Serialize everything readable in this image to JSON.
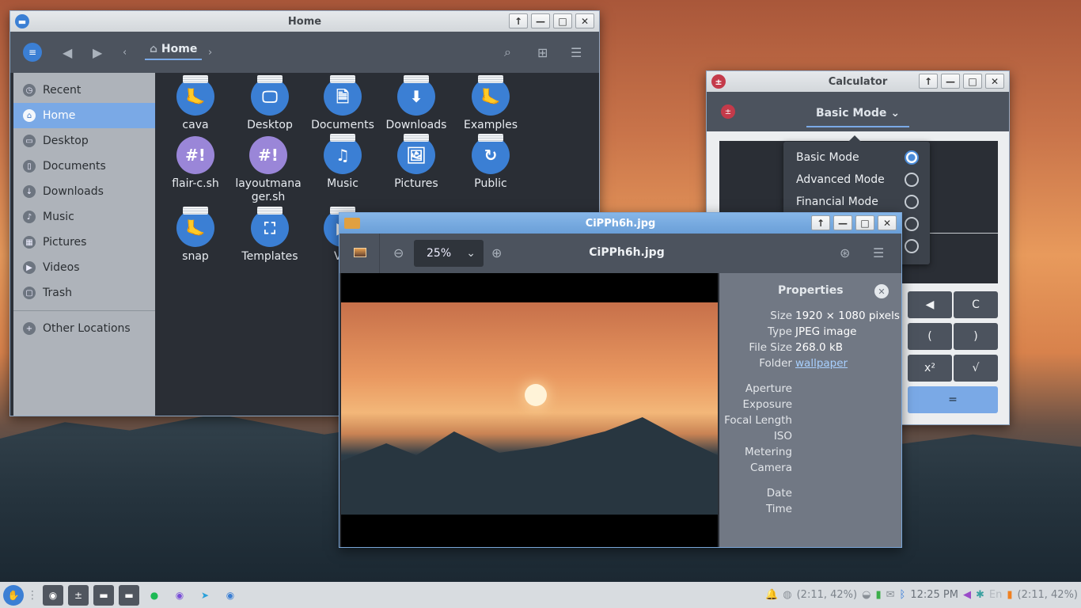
{
  "files_window": {
    "title": "Home",
    "breadcrumb": "Home",
    "sidebar": [
      {
        "label": "Recent",
        "icon": "clock-icon"
      },
      {
        "label": "Home",
        "icon": "home-icon",
        "active": true
      },
      {
        "label": "Desktop",
        "icon": "desktop-icon"
      },
      {
        "label": "Documents",
        "icon": "documents-icon"
      },
      {
        "label": "Downloads",
        "icon": "downloads-icon"
      },
      {
        "label": "Music",
        "icon": "music-icon"
      },
      {
        "label": "Pictures",
        "icon": "pictures-icon"
      },
      {
        "label": "Videos",
        "icon": "videos-icon"
      },
      {
        "label": "Trash",
        "icon": "trash-icon"
      },
      {
        "label": "Other Locations",
        "icon": "plus-icon"
      }
    ],
    "items": [
      {
        "label": "cava",
        "glyph": "🦶",
        "kind": "folder"
      },
      {
        "label": "Desktop",
        "glyph": "🖵",
        "kind": "folder"
      },
      {
        "label": "Documents",
        "glyph": "🗎",
        "kind": "folder"
      },
      {
        "label": "Downloads",
        "glyph": "⬇",
        "kind": "folder"
      },
      {
        "label": "Examples",
        "glyph": "🦶",
        "kind": "folder"
      },
      {
        "label": "flair-c.sh",
        "glyph": "#!",
        "kind": "script"
      },
      {
        "label": "layoutmanager.sh",
        "glyph": "#!",
        "kind": "script"
      },
      {
        "label": "Music",
        "glyph": "♫",
        "kind": "folder"
      },
      {
        "label": "Pictures",
        "glyph": "🖼",
        "kind": "folder"
      },
      {
        "label": "Public",
        "glyph": "↻",
        "kind": "folder"
      },
      {
        "label": "snap",
        "glyph": "🦶",
        "kind": "folder"
      },
      {
        "label": "Templates",
        "glyph": "⛶",
        "kind": "folder"
      },
      {
        "label": "Vid",
        "glyph": "▶",
        "kind": "folder"
      }
    ]
  },
  "calculator": {
    "title": "Calculator",
    "mode": "Basic Mode",
    "modes": [
      "Basic Mode",
      "Advanced Mode",
      "Financial Mode",
      "",
      ""
    ],
    "keys": [
      "◀",
      "C",
      "(",
      ")",
      "x²",
      "√",
      "="
    ]
  },
  "viewer": {
    "title": "CiPPh6h.jpg",
    "header": "CiPPh6h.jpg",
    "zoom": "25%",
    "properties_title": "Properties",
    "properties": [
      {
        "label": "Size",
        "value": "1920 × 1080 pixels"
      },
      {
        "label": "Type",
        "value": "JPEG image"
      },
      {
        "label": "File Size",
        "value": "268.0 kB"
      },
      {
        "label": "Folder",
        "value": "wallpaper",
        "link": true
      },
      {
        "label": "Aperture",
        "value": ""
      },
      {
        "label": "Exposure",
        "value": ""
      },
      {
        "label": "Focal Length",
        "value": ""
      },
      {
        "label": "ISO",
        "value": ""
      },
      {
        "label": "Metering",
        "value": ""
      },
      {
        "label": "Camera",
        "value": ""
      },
      {
        "label": "Date",
        "value": ""
      },
      {
        "label": "Time",
        "value": ""
      }
    ]
  },
  "taskbar": {
    "battery1": "(2:11, 42%)",
    "clock": "12:25 PM",
    "lang": "En",
    "battery2": "(2:11, 42%)"
  },
  "colors": {
    "accent": "#3b7fd4",
    "selection": "#7aa9e6"
  }
}
